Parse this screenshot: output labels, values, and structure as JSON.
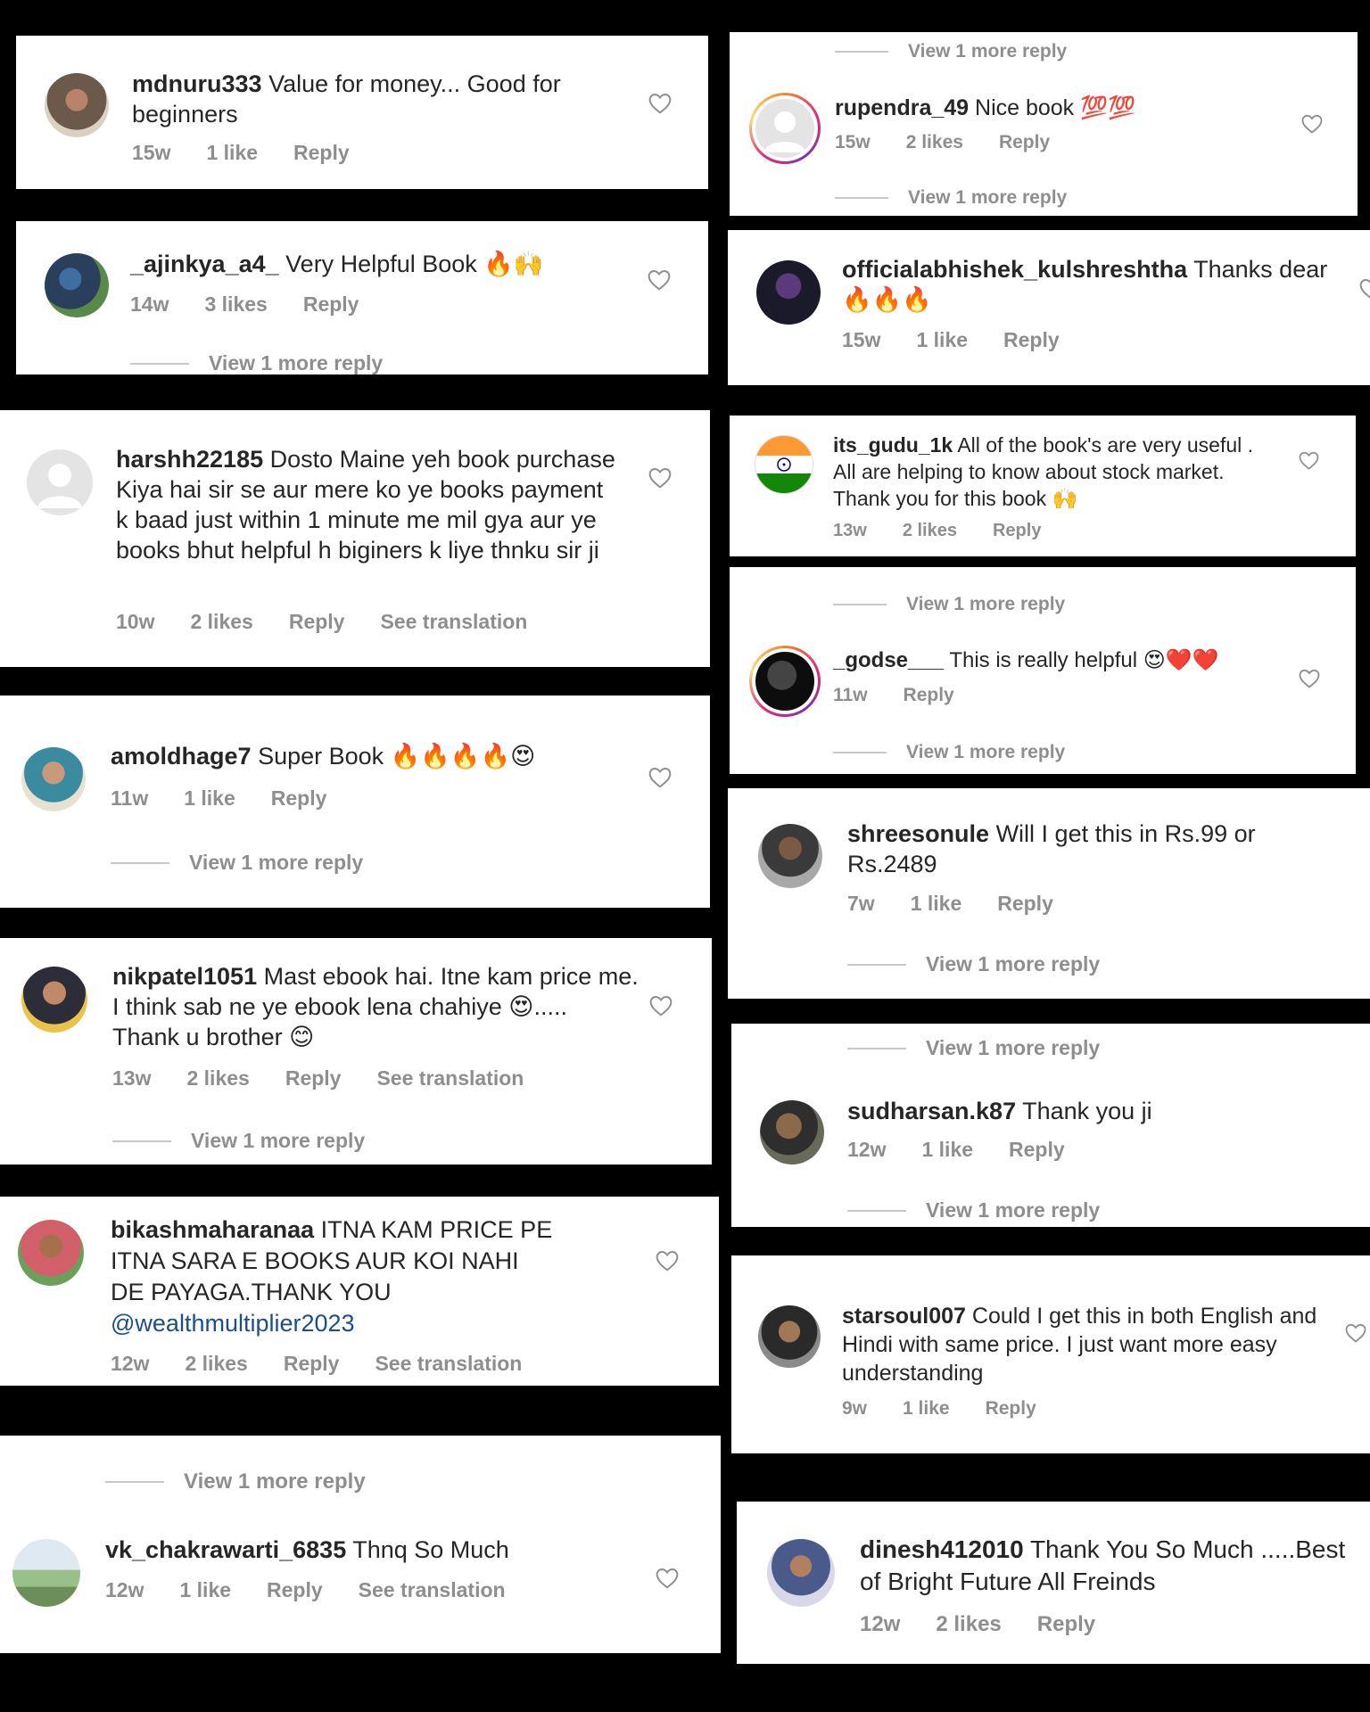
{
  "colors": {
    "background": "#000000",
    "card": "#ffffff",
    "username": "#262626",
    "meta": "#8e8e8e",
    "mention": "#1c4f8a"
  },
  "comments": [
    {
      "user": "mdnuru333",
      "text": "Value for money... Good for beginners",
      "age": "15w",
      "likes": "1 like",
      "reply": "Reply"
    },
    {
      "user": "_ajinkya_a4_",
      "text": "Very Helpful Book 🔥🙌",
      "age": "14w",
      "likes": "3 likes",
      "reply": "Reply",
      "more": "View 1 more reply"
    },
    {
      "user": "harshh22185",
      "text": "Dosto Maine yeh book purchase Kiya hai sir se aur mere ko ye books payment k baad just within 1 minute me mil gya aur ye books bhut helpful h biginers k liye thnku sir ji",
      "age": "10w",
      "likes": "2 likes",
      "reply": "Reply",
      "translate": "See translation"
    },
    {
      "user": "amoldhage7",
      "text": "Super Book 🔥🔥🔥🔥😍",
      "age": "11w",
      "likes": "1 like",
      "reply": "Reply",
      "more": "View 1 more reply"
    },
    {
      "user": "nikpatel1051",
      "text": "Mast ebook hai. Itne kam price me. I think sab ne ye ebook lena chahiye 😍..... Thank u brother 😊",
      "age": "13w",
      "likes": "2 likes",
      "reply": "Reply",
      "translate": "See translation",
      "more": "View 1 more reply"
    },
    {
      "user": "bikashmaharanaa",
      "text": "ITNA KAM PRICE PE ITNA SARA E BOOKS AUR KOI NAHI DE PAYAGA.THANK YOU",
      "mention": "@wealthmultiplier2023",
      "age": "12w",
      "likes": "2 likes",
      "reply": "Reply",
      "translate": "See translation"
    },
    {
      "user": "vk_chakrawarti_6835",
      "text": "Thnq So Much",
      "age": "12w",
      "likes": "1 like",
      "reply": "Reply",
      "translate": "See translation",
      "more_before": "View 1 more reply"
    },
    {
      "user": "rupendra_49",
      "text": "Nice book 💯💯",
      "age": "15w",
      "likes": "2 likes",
      "reply": "Reply",
      "more_before": "View 1 more reply",
      "more": "View 1 more reply"
    },
    {
      "user": "officialabhishek_kulshreshtha",
      "text": "Thanks dear 🔥🔥🔥",
      "age": "15w",
      "likes": "1 like",
      "reply": "Reply"
    },
    {
      "user": "its_gudu_1k",
      "text": "All of the book's are very useful . All are helping to know about stock market. Thank you for this book 🙌",
      "age": "13w",
      "likes": "2 likes",
      "reply": "Reply"
    },
    {
      "user": "_godse___",
      "text": "This is really helpful 😍❤️❤️",
      "age": "11w",
      "reply": "Reply",
      "more_before": "View 1 more reply",
      "more": "View 1 more reply"
    },
    {
      "user": "shreesonule",
      "text": "Will I get this in Rs.99 or Rs.2489",
      "age": "7w",
      "likes": "1 like",
      "reply": "Reply",
      "more": "View 1 more reply"
    },
    {
      "user": "sudharsan.k87",
      "text": "Thank you ji",
      "age": "12w",
      "likes": "1 like",
      "reply": "Reply",
      "more_before": "View 1 more reply",
      "more": "View 1 more reply"
    },
    {
      "user": "starsoul007",
      "text": "Could I get this in both English and Hindi with same price. I just want more easy understanding",
      "age": "9w",
      "likes": "1 like",
      "reply": "Reply"
    },
    {
      "user": "dinesh412010",
      "text": "Thank You So Much .....Best of Bright Future All Freinds",
      "age": "12w",
      "likes": "2 likes",
      "reply": "Reply"
    }
  ]
}
